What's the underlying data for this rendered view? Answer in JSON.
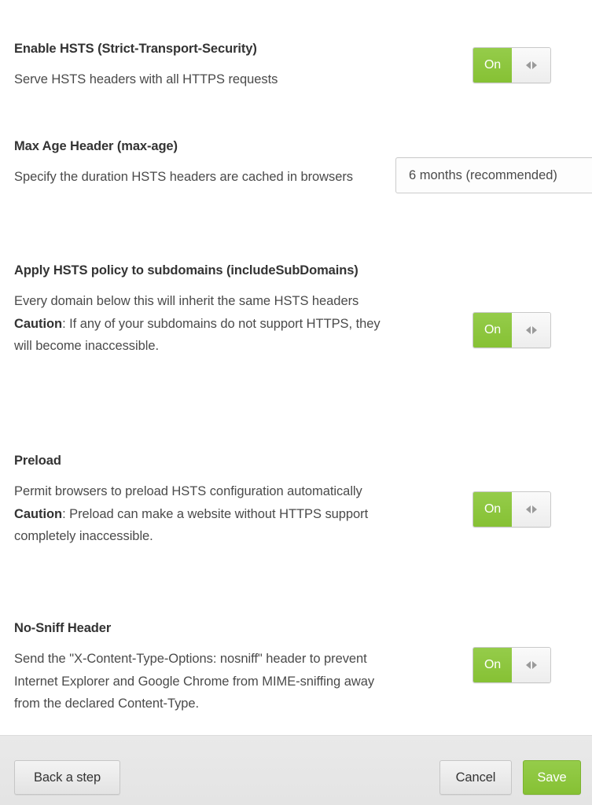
{
  "settings": [
    {
      "id": "enable-hsts",
      "title": "Enable HSTS (Strict-Transport-Security)",
      "desc": "Serve HSTS headers with all HTTPS requests",
      "control": "toggle",
      "value": "On"
    },
    {
      "id": "max-age-header",
      "title": "Max Age Header (max-age)",
      "desc": "Specify the duration HSTS headers are cached in browsers",
      "control": "select",
      "value": "6 months (recommended)"
    },
    {
      "id": "include-subdomains",
      "title": "Apply HSTS policy to subdomains (includeSubDomains)",
      "desc_line1": "Every domain below this will inherit the same HSTS headers",
      "caution_label": "Caution",
      "desc_line2": ": If any of your subdomains do not support HTTPS, they will become inaccessible.",
      "control": "toggle",
      "value": "On"
    },
    {
      "id": "preload",
      "title": "Preload",
      "desc_line1": "Permit browsers to preload HSTS configuration automatically",
      "caution_label": "Caution",
      "desc_line2": ": Preload can make a website without HTTPS support completely inaccessible.",
      "control": "toggle",
      "value": "On"
    },
    {
      "id": "no-sniff-header",
      "title": "No-Sniff Header",
      "desc": "Send the \"X-Content-Type-Options: nosniff\" header to prevent Internet Explorer and Google Chrome from MIME-sniffing away from the declared Content-Type.",
      "control": "toggle",
      "value": "On"
    }
  ],
  "footer": {
    "back_label": "Back a step",
    "cancel_label": "Cancel",
    "save_label": "Save"
  },
  "colors": {
    "accent_green": "#8cc63e",
    "footer_bg": "#e7e7e7",
    "text": "#3b3b3b"
  }
}
